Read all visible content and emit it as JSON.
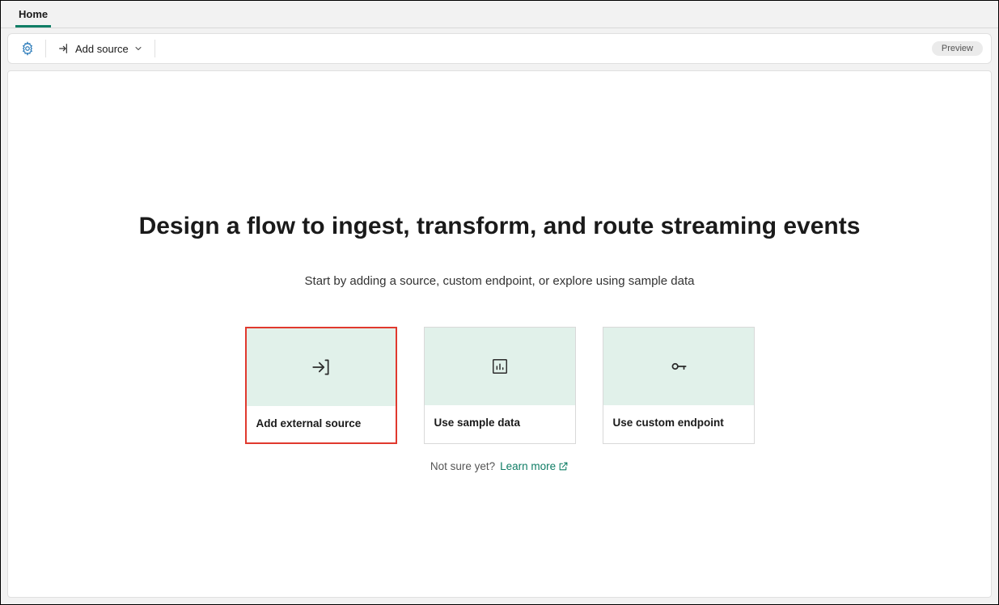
{
  "tabs": {
    "home": "Home"
  },
  "toolbar": {
    "add_source_label": "Add source",
    "preview_badge": "Preview"
  },
  "hero": {
    "title": "Design a flow to ingest, transform, and route streaming events",
    "subtitle": "Start by adding a source, custom endpoint, or explore using sample data"
  },
  "cards": {
    "external": "Add external source",
    "sample": "Use sample data",
    "endpoint": "Use custom endpoint"
  },
  "footer": {
    "prompt": "Not sure yet?",
    "learn_more": "Learn more"
  }
}
